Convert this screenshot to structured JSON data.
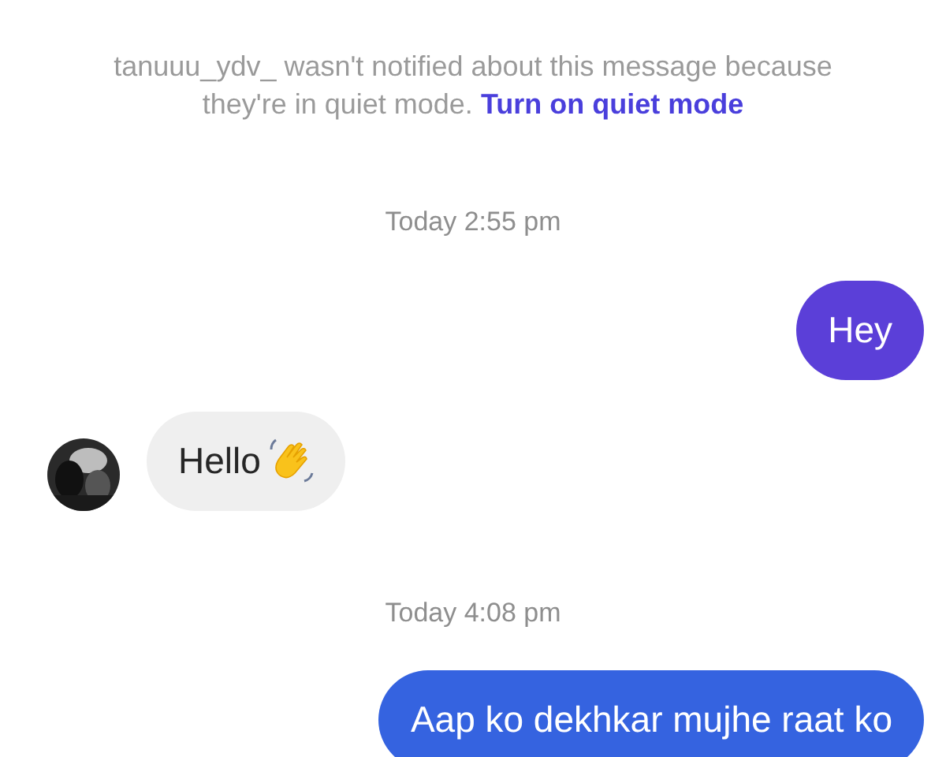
{
  "messages": [
    {
      "kind": "notice",
      "text": "tanuuu_ydv_ wasn't notified about this message because they're in quiet mode.",
      "link": "Turn on quiet mode"
    },
    {
      "kind": "timestamp",
      "text": "Today 2:55 pm"
    },
    {
      "kind": "outgoing",
      "text": "Hey",
      "color": "#5b3fd8"
    },
    {
      "kind": "incoming",
      "text": "Hello"
    },
    {
      "kind": "timestamp",
      "text": "Today 4:08 pm"
    },
    {
      "kind": "outgoing",
      "text": "Aap ko dekhkar mujhe raat ko",
      "color": "#3563e0"
    }
  ]
}
